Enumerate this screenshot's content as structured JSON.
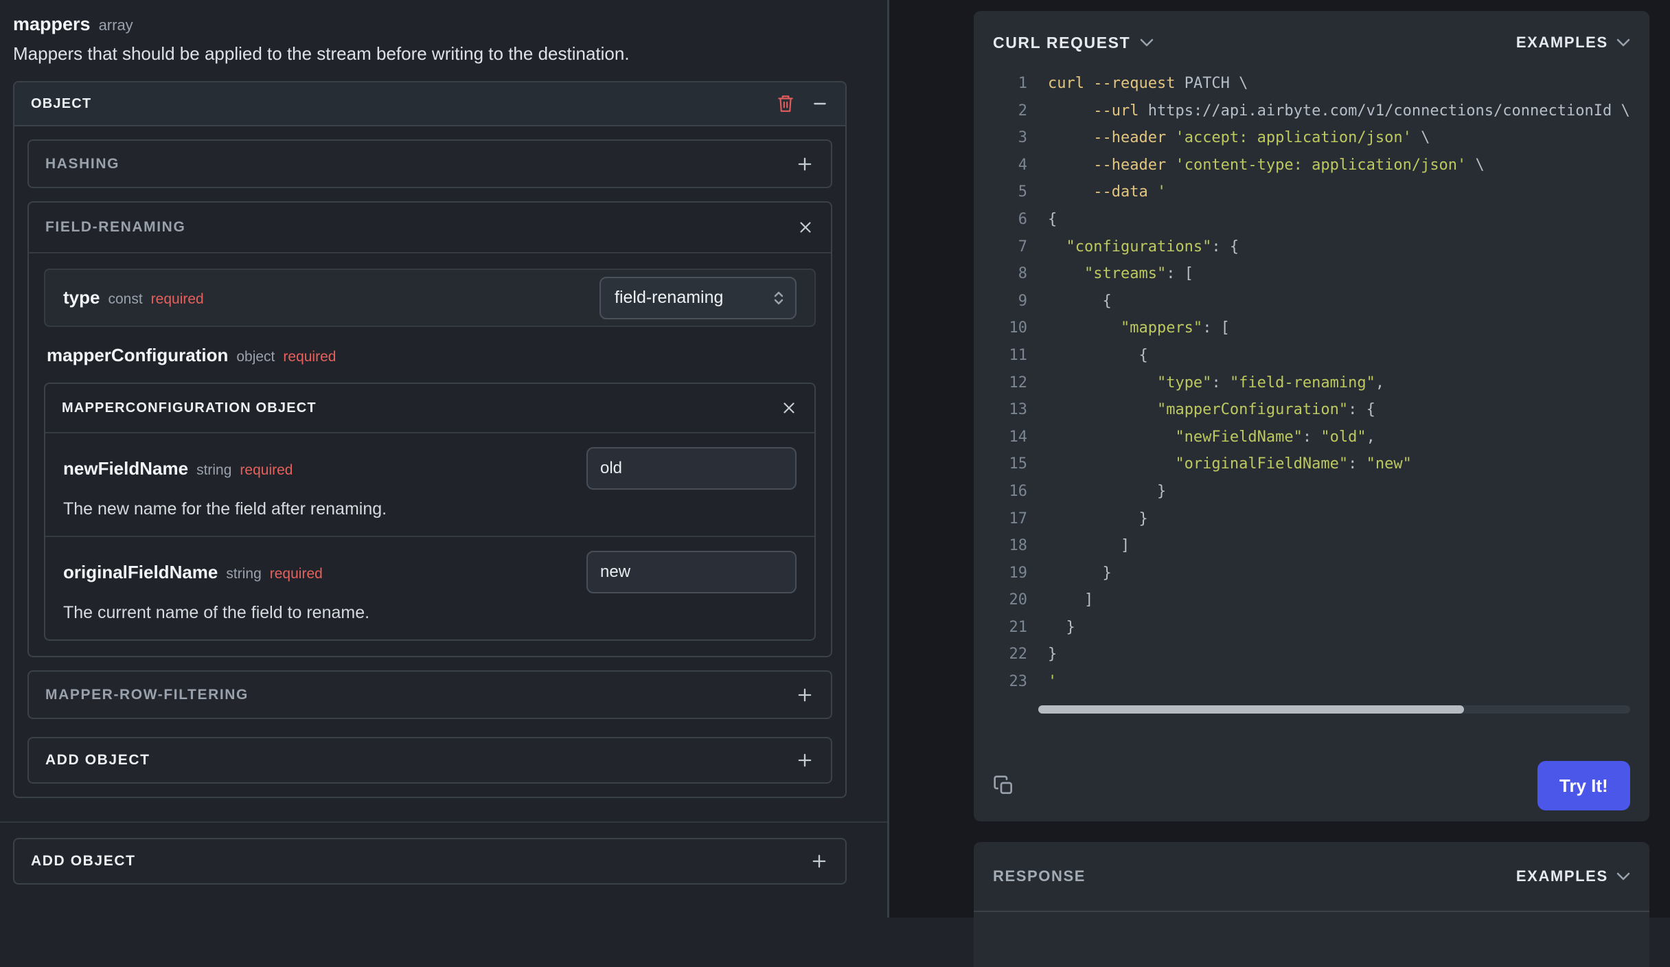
{
  "colors": {
    "accent": "#4a57e9",
    "required": "#e6605c",
    "code_flag": "#e3c57f",
    "code_string": "#bdc85f"
  },
  "left": {
    "field_name": "mappers",
    "field_kind": "array",
    "description": "Mappers that should be applied to the stream before writing to the destination.",
    "object_panel": {
      "title": "OBJECT",
      "hashing_label": "HASHING",
      "field_renaming": {
        "label": "FIELD-RENAMING",
        "type_field": {
          "name": "type",
          "kind": "const",
          "required": "required",
          "value": "field-renaming"
        },
        "mapper_configuration": {
          "name": "mapperConfiguration",
          "kind": "object",
          "required": "required",
          "panel_title": "MAPPERCONFIGURATION OBJECT",
          "fields": [
            {
              "name": "newFieldName",
              "kind": "string",
              "required": "required",
              "value": "old",
              "description": "The new name for the field after renaming."
            },
            {
              "name": "originalFieldName",
              "kind": "string",
              "required": "required",
              "value": "new",
              "description": "The current name of the field to rename."
            }
          ]
        }
      },
      "row_filtering_label": "MAPPER-ROW-FILTERING",
      "add_object_label": "ADD OBJECT"
    },
    "add_object_bottom_label": "ADD OBJECT"
  },
  "right": {
    "curl": {
      "title": "CURL REQUEST",
      "examples_label": "EXAMPLES",
      "try_button_label": "Try It!",
      "code": {
        "language": "shell",
        "lines": [
          [
            [
              "k",
              "curl"
            ],
            [
              "p",
              " "
            ],
            [
              "k",
              "--request"
            ],
            [
              "p",
              " PATCH \\"
            ]
          ],
          [
            [
              "p",
              "     "
            ],
            [
              "k",
              "--url"
            ],
            [
              "p",
              " https://api.airbyte.com/v1/connections/connectionId \\"
            ]
          ],
          [
            [
              "p",
              "     "
            ],
            [
              "k",
              "--header"
            ],
            [
              "p",
              " "
            ],
            [
              "s",
              "'accept: application/json'"
            ],
            [
              "p",
              " \\"
            ]
          ],
          [
            [
              "p",
              "     "
            ],
            [
              "k",
              "--header"
            ],
            [
              "p",
              " "
            ],
            [
              "s",
              "'content-type: application/json'"
            ],
            [
              "p",
              " \\"
            ]
          ],
          [
            [
              "p",
              "     "
            ],
            [
              "k",
              "--data"
            ],
            [
              "p",
              " "
            ],
            [
              "s",
              "'"
            ]
          ],
          [
            [
              "p",
              "{"
            ]
          ],
          [
            [
              "p",
              "  "
            ],
            [
              "s",
              "\"configurations\""
            ],
            [
              "p",
              ": {"
            ]
          ],
          [
            [
              "p",
              "    "
            ],
            [
              "s",
              "\"streams\""
            ],
            [
              "p",
              ": ["
            ]
          ],
          [
            [
              "p",
              "      {"
            ]
          ],
          [
            [
              "p",
              "        "
            ],
            [
              "s",
              "\"mappers\""
            ],
            [
              "p",
              ": ["
            ]
          ],
          [
            [
              "p",
              "          {"
            ]
          ],
          [
            [
              "p",
              "            "
            ],
            [
              "s",
              "\"type\""
            ],
            [
              "p",
              ": "
            ],
            [
              "s",
              "\"field-renaming\""
            ],
            [
              "p",
              ","
            ]
          ],
          [
            [
              "p",
              "            "
            ],
            [
              "s",
              "\"mapperConfiguration\""
            ],
            [
              "p",
              ": {"
            ]
          ],
          [
            [
              "p",
              "              "
            ],
            [
              "s",
              "\"newFieldName\""
            ],
            [
              "p",
              ": "
            ],
            [
              "s",
              "\"old\""
            ],
            [
              "p",
              ","
            ]
          ],
          [
            [
              "p",
              "              "
            ],
            [
              "s",
              "\"originalFieldName\""
            ],
            [
              "p",
              ": "
            ],
            [
              "s",
              "\"new\""
            ]
          ],
          [
            [
              "p",
              "            }"
            ]
          ],
          [
            [
              "p",
              "          }"
            ]
          ],
          [
            [
              "p",
              "        ]"
            ]
          ],
          [
            [
              "p",
              "      }"
            ]
          ],
          [
            [
              "p",
              "    ]"
            ]
          ],
          [
            [
              "p",
              "  }"
            ]
          ],
          [
            [
              "p",
              "}"
            ]
          ],
          [
            [
              "s",
              "'"
            ]
          ]
        ]
      }
    },
    "response": {
      "title": "RESPONSE",
      "examples_label": "EXAMPLES"
    }
  }
}
